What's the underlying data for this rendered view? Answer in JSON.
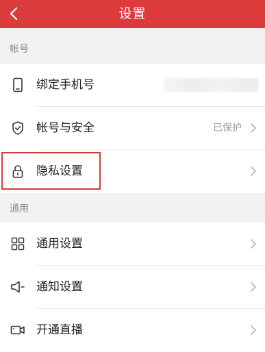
{
  "header": {
    "title": "设置"
  },
  "sections": {
    "account": {
      "label": "帐号",
      "items": [
        {
          "label": "绑定手机号",
          "value": "",
          "icon": "phone-icon"
        },
        {
          "label": "帐号与安全",
          "value": "已保护",
          "icon": "shield-icon"
        },
        {
          "label": "隐私设置",
          "value": "",
          "icon": "lock-icon"
        }
      ]
    },
    "general": {
      "label": "通用",
      "items": [
        {
          "label": "通用设置",
          "value": "",
          "icon": "grid-icon"
        },
        {
          "label": "通知设置",
          "value": "",
          "icon": "speaker-icon"
        },
        {
          "label": "开通直播",
          "value": "",
          "icon": "video-camera-icon"
        }
      ]
    }
  },
  "colors": {
    "header_bg": "#dc3b3b",
    "highlight_border": "#d23b3b"
  }
}
